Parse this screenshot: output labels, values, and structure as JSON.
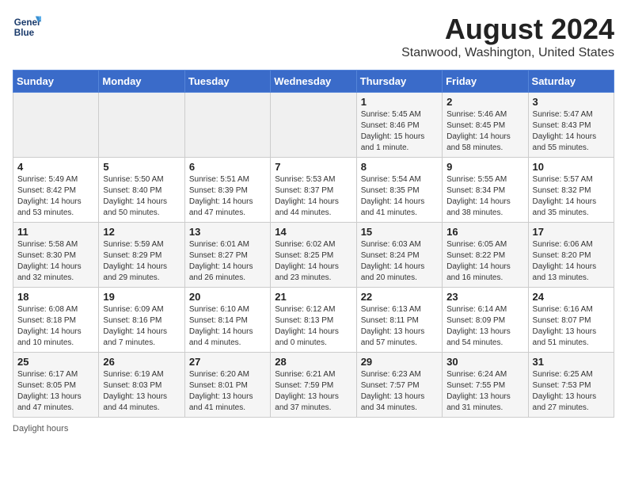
{
  "header": {
    "logo_line1": "General",
    "logo_line2": "Blue",
    "title": "August 2024",
    "subtitle": "Stanwood, Washington, United States"
  },
  "days_of_week": [
    "Sunday",
    "Monday",
    "Tuesday",
    "Wednesday",
    "Thursday",
    "Friday",
    "Saturday"
  ],
  "weeks": [
    [
      {
        "day": "",
        "info": ""
      },
      {
        "day": "",
        "info": ""
      },
      {
        "day": "",
        "info": ""
      },
      {
        "day": "",
        "info": ""
      },
      {
        "day": "1",
        "info": "Sunrise: 5:45 AM\nSunset: 8:46 PM\nDaylight: 15 hours\nand 1 minute."
      },
      {
        "day": "2",
        "info": "Sunrise: 5:46 AM\nSunset: 8:45 PM\nDaylight: 14 hours\nand 58 minutes."
      },
      {
        "day": "3",
        "info": "Sunrise: 5:47 AM\nSunset: 8:43 PM\nDaylight: 14 hours\nand 55 minutes."
      }
    ],
    [
      {
        "day": "4",
        "info": "Sunrise: 5:49 AM\nSunset: 8:42 PM\nDaylight: 14 hours\nand 53 minutes."
      },
      {
        "day": "5",
        "info": "Sunrise: 5:50 AM\nSunset: 8:40 PM\nDaylight: 14 hours\nand 50 minutes."
      },
      {
        "day": "6",
        "info": "Sunrise: 5:51 AM\nSunset: 8:39 PM\nDaylight: 14 hours\nand 47 minutes."
      },
      {
        "day": "7",
        "info": "Sunrise: 5:53 AM\nSunset: 8:37 PM\nDaylight: 14 hours\nand 44 minutes."
      },
      {
        "day": "8",
        "info": "Sunrise: 5:54 AM\nSunset: 8:35 PM\nDaylight: 14 hours\nand 41 minutes."
      },
      {
        "day": "9",
        "info": "Sunrise: 5:55 AM\nSunset: 8:34 PM\nDaylight: 14 hours\nand 38 minutes."
      },
      {
        "day": "10",
        "info": "Sunrise: 5:57 AM\nSunset: 8:32 PM\nDaylight: 14 hours\nand 35 minutes."
      }
    ],
    [
      {
        "day": "11",
        "info": "Sunrise: 5:58 AM\nSunset: 8:30 PM\nDaylight: 14 hours\nand 32 minutes."
      },
      {
        "day": "12",
        "info": "Sunrise: 5:59 AM\nSunset: 8:29 PM\nDaylight: 14 hours\nand 29 minutes."
      },
      {
        "day": "13",
        "info": "Sunrise: 6:01 AM\nSunset: 8:27 PM\nDaylight: 14 hours\nand 26 minutes."
      },
      {
        "day": "14",
        "info": "Sunrise: 6:02 AM\nSunset: 8:25 PM\nDaylight: 14 hours\nand 23 minutes."
      },
      {
        "day": "15",
        "info": "Sunrise: 6:03 AM\nSunset: 8:24 PM\nDaylight: 14 hours\nand 20 minutes."
      },
      {
        "day": "16",
        "info": "Sunrise: 6:05 AM\nSunset: 8:22 PM\nDaylight: 14 hours\nand 16 minutes."
      },
      {
        "day": "17",
        "info": "Sunrise: 6:06 AM\nSunset: 8:20 PM\nDaylight: 14 hours\nand 13 minutes."
      }
    ],
    [
      {
        "day": "18",
        "info": "Sunrise: 6:08 AM\nSunset: 8:18 PM\nDaylight: 14 hours\nand 10 minutes."
      },
      {
        "day": "19",
        "info": "Sunrise: 6:09 AM\nSunset: 8:16 PM\nDaylight: 14 hours\nand 7 minutes."
      },
      {
        "day": "20",
        "info": "Sunrise: 6:10 AM\nSunset: 8:14 PM\nDaylight: 14 hours\nand 4 minutes."
      },
      {
        "day": "21",
        "info": "Sunrise: 6:12 AM\nSunset: 8:13 PM\nDaylight: 14 hours\nand 0 minutes."
      },
      {
        "day": "22",
        "info": "Sunrise: 6:13 AM\nSunset: 8:11 PM\nDaylight: 13 hours\nand 57 minutes."
      },
      {
        "day": "23",
        "info": "Sunrise: 6:14 AM\nSunset: 8:09 PM\nDaylight: 13 hours\nand 54 minutes."
      },
      {
        "day": "24",
        "info": "Sunrise: 6:16 AM\nSunset: 8:07 PM\nDaylight: 13 hours\nand 51 minutes."
      }
    ],
    [
      {
        "day": "25",
        "info": "Sunrise: 6:17 AM\nSunset: 8:05 PM\nDaylight: 13 hours\nand 47 minutes."
      },
      {
        "day": "26",
        "info": "Sunrise: 6:19 AM\nSunset: 8:03 PM\nDaylight: 13 hours\nand 44 minutes."
      },
      {
        "day": "27",
        "info": "Sunrise: 6:20 AM\nSunset: 8:01 PM\nDaylight: 13 hours\nand 41 minutes."
      },
      {
        "day": "28",
        "info": "Sunrise: 6:21 AM\nSunset: 7:59 PM\nDaylight: 13 hours\nand 37 minutes."
      },
      {
        "day": "29",
        "info": "Sunrise: 6:23 AM\nSunset: 7:57 PM\nDaylight: 13 hours\nand 34 minutes."
      },
      {
        "day": "30",
        "info": "Sunrise: 6:24 AM\nSunset: 7:55 PM\nDaylight: 13 hours\nand 31 minutes."
      },
      {
        "day": "31",
        "info": "Sunrise: 6:25 AM\nSunset: 7:53 PM\nDaylight: 13 hours\nand 27 minutes."
      }
    ]
  ],
  "footer": "Daylight hours"
}
